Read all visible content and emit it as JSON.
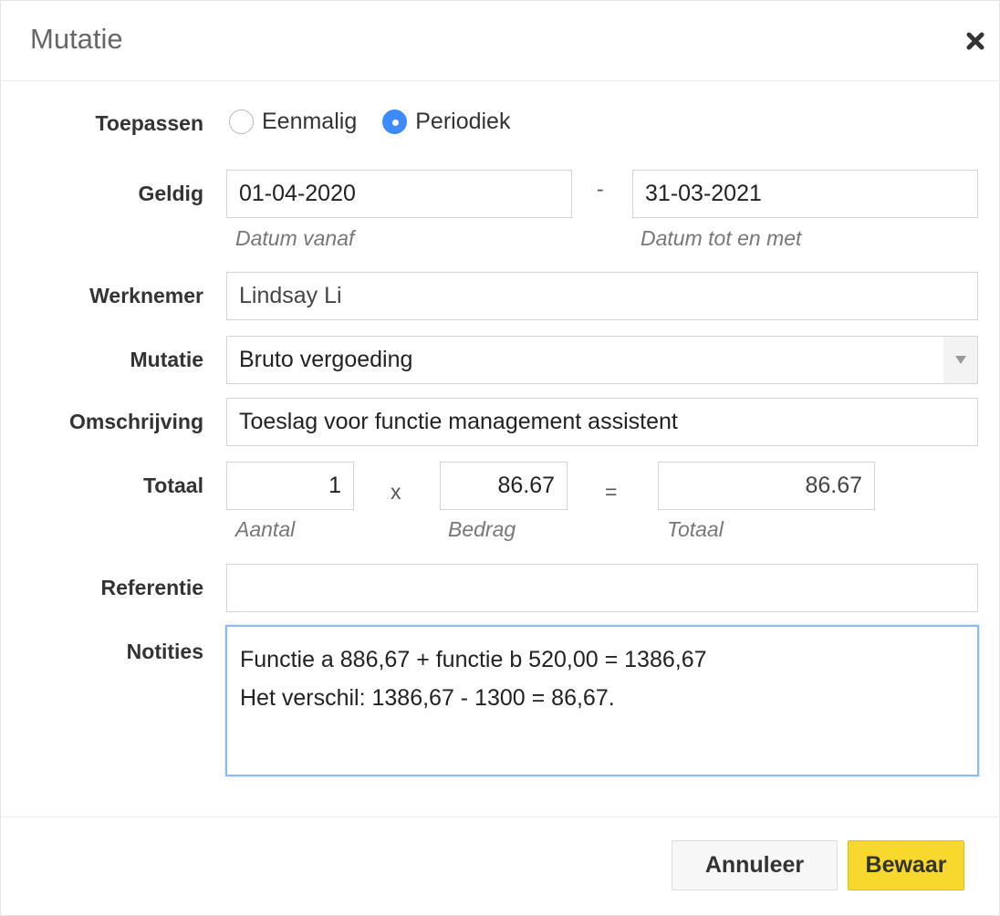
{
  "dialog": {
    "title": "Mutatie",
    "close_icon": "close-icon"
  },
  "form": {
    "toepassen": {
      "label": "Toepassen",
      "options": [
        {
          "label": "Eenmalig",
          "checked": false
        },
        {
          "label": "Periodiek",
          "checked": true
        }
      ]
    },
    "geldig": {
      "label": "Geldig",
      "from_value": "01-04-2020",
      "from_hint": "Datum vanaf",
      "separator": "-",
      "to_value": "31-03-2021",
      "to_hint": "Datum tot en met"
    },
    "werknemer": {
      "label": "Werknemer",
      "value": "Lindsay Li"
    },
    "mutatie": {
      "label": "Mutatie",
      "value": "Bruto vergoeding"
    },
    "omschrijving": {
      "label": "Omschrijving",
      "value": "Toeslag voor functie management assistent"
    },
    "totaal": {
      "label": "Totaal",
      "aantal_value": "1",
      "aantal_hint": "Aantal",
      "times": "x",
      "bedrag_value": "86.67",
      "bedrag_hint": "Bedrag",
      "equals": "=",
      "totaal_value": "86.67",
      "totaal_hint": "Totaal"
    },
    "referentie": {
      "label": "Referentie",
      "value": ""
    },
    "notities": {
      "label": "Notities",
      "lines": [
        "Functie a 886,67 + functie b 520,00 = 1386,67",
        "Het verschil: 1386,67 - 1300 = 86,67."
      ]
    }
  },
  "footer": {
    "cancel_label": "Annuleer",
    "save_label": "Bewaar"
  },
  "colors": {
    "accent": "#3d8bff",
    "save_button": "#f9d82e",
    "focus_border": "#8fb8f1"
  }
}
